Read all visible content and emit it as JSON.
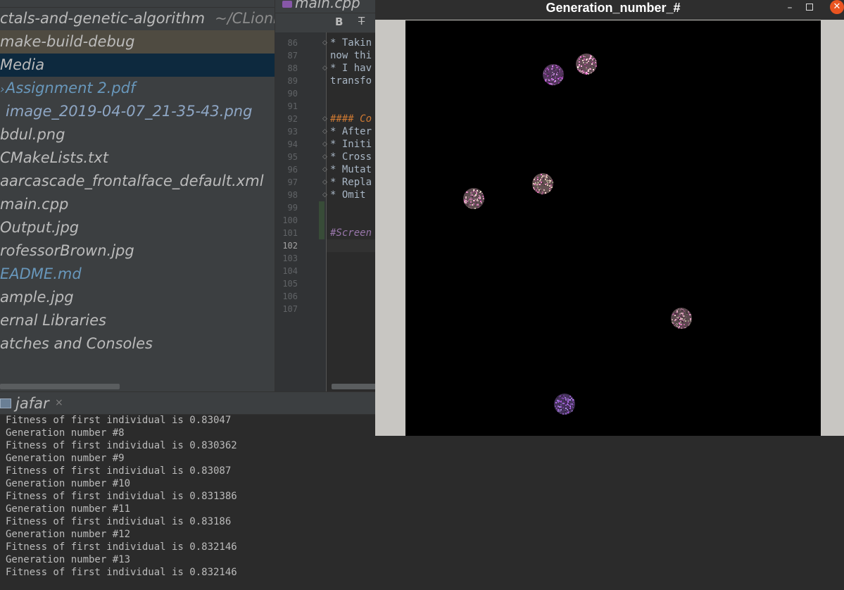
{
  "project": {
    "root_label": "ctals-and-genetic-algorithm",
    "root_path": "~/CLionP",
    "items": [
      {
        "label": "make-build-debug"
      },
      {
        "label": "Media"
      },
      {
        "label": "Assignment 2.pdf"
      },
      {
        "label": "image_2019-04-07_21-35-43.png"
      },
      {
        "label": "bdul.png"
      },
      {
        "label": "CMakeLists.txt"
      },
      {
        "label": "aarcascade_frontalface_default.xml"
      },
      {
        "label": "main.cpp"
      },
      {
        "label": "Output.jpg"
      },
      {
        "label": "rofessorBrown.jpg"
      },
      {
        "label": "EADME.md"
      },
      {
        "label": "ample.jpg"
      },
      {
        "label": "ernal Libraries"
      },
      {
        "label": "atches and Consoles"
      }
    ]
  },
  "editor": {
    "tab_label": "main.cpp",
    "toolbar": {
      "bold": "B",
      "strike": "T"
    },
    "line_numbers": [
      "86",
      "87",
      "88",
      "89",
      "90",
      "91",
      "92",
      "93",
      "94",
      "95",
      "96",
      "97",
      "98",
      "99",
      "100",
      "101",
      "102",
      "103",
      "104",
      "105",
      "106",
      "107"
    ],
    "current_line": "102",
    "lines": [
      "* Takin",
      "now thi",
      "* I hav",
      "transfo",
      "",
      "",
      "#### Co",
      "* After",
      "* Initi",
      "* Cross",
      "* Mutat",
      "* Repla",
      "* Omit",
      "",
      "",
      "#Screen",
      "",
      "",
      "",
      "",
      "",
      ""
    ]
  },
  "run": {
    "config_name": "jafar",
    "close_glyph": "×",
    "output": [
      "Fitness of first individual is 0.83047",
      "Generation number #8",
      "Fitness of first individual is 0.830362",
      "Generation number #9",
      "Fitness of first individual is 0.83087",
      "Generation number #10",
      "Fitness of first individual is 0.831386",
      "Generation number #11",
      "Fitness of first individual is 0.83186",
      "Generation number #12",
      "Fitness of first individual is 0.832146",
      "Generation number #13",
      "Fitness of first individual is 0.832146"
    ]
  },
  "window": {
    "title": "Generation_number_#",
    "minimize_glyph": "–",
    "close_glyph": "✕"
  },
  "colors": {
    "window_close": "#e95420",
    "selection_blue": "#0d293e",
    "selection_yellow": "#4f4b41",
    "canvas": "#000000"
  }
}
